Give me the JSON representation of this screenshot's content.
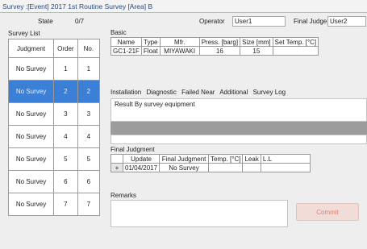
{
  "window": {
    "title": "Survey :[Event] 2017 1st Routine Survey  [Area] B"
  },
  "state": {
    "label": "State",
    "value": "0/7"
  },
  "operator": {
    "label": "Operator",
    "value": "User1"
  },
  "final_judge": {
    "label": "Final Judge",
    "value": "User2"
  },
  "survey_list": {
    "title": "Survey List",
    "headers": [
      "Judgment",
      "Order",
      "No."
    ],
    "rows": [
      {
        "judgment": "No Survey",
        "order": "1",
        "no": "1"
      },
      {
        "judgment": "No Survey",
        "order": "2",
        "no": "2"
      },
      {
        "judgment": "No Survey",
        "order": "3",
        "no": "3"
      },
      {
        "judgment": "No Survey",
        "order": "4",
        "no": "4"
      },
      {
        "judgment": "No Survey",
        "order": "5",
        "no": "5"
      },
      {
        "judgment": "No Survey",
        "order": "6",
        "no": "6"
      },
      {
        "judgment": "No Survey",
        "order": "7",
        "no": "7"
      }
    ],
    "selected_row": 2
  },
  "basic": {
    "title": "Basic",
    "headers": [
      "Name",
      "Type",
      "Mfr.",
      "Press. [barg]",
      "Size [mm]",
      "Set Temp. [°C]"
    ],
    "row": [
      "GC1-21F",
      "Float",
      "MIYAWAKI",
      "16",
      "15",
      ""
    ]
  },
  "tabs": [
    "Installation",
    "Diagnostic",
    "Failed Near",
    "Additional",
    "Survey Log"
  ],
  "result": {
    "title": "Result By survey equipment"
  },
  "final_judgment": {
    "title": "Final Judgment",
    "headers": [
      "Update",
      "Final Judgment",
      "Temp. [°C]",
      "Leak",
      "L.L"
    ],
    "row": {
      "expander": "+",
      "update": "01/04/2017",
      "judgment": "No Survey"
    }
  },
  "remarks": {
    "title": "Remarks"
  },
  "confirm_button": {
    "label": "Commit"
  }
}
